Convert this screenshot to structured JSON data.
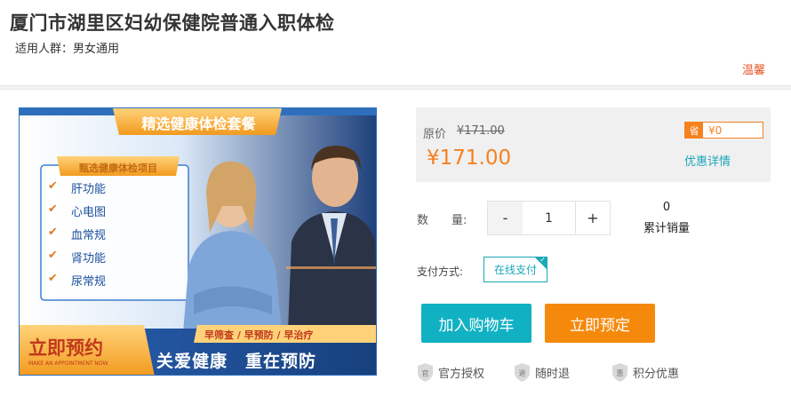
{
  "header": {
    "title": "厦门市湖里区妇幼保健院普通入职体检",
    "applicable": "适用人群：男女通用",
    "tag_link": "温馨"
  },
  "banner": {
    "title": "精选健康体检套餐",
    "subtitle": "甄选健康体检项目",
    "items": [
      "肝功能",
      "心电图",
      "血常规",
      "肾功能",
      "尿常规"
    ],
    "check_glyph": "✔",
    "cta": "立即预约",
    "cta_sub": "MAKE AN APPOINTMENT NOW",
    "strip": "早筛查 / 早预防 / 早治疗",
    "slogan": "关爱健康　重在预防"
  },
  "price": {
    "original_label": "原价",
    "original_value": "¥171.00",
    "current_value": "¥171.00",
    "save_icon_label": "省",
    "save_amount": "¥0",
    "promo_link": "优惠详情"
  },
  "quantity": {
    "label": "数　　量:",
    "minus": "-",
    "plus": "+",
    "value": "1",
    "sold_count": "0",
    "sold_label": "累计销量"
  },
  "payment": {
    "label": "支付方式:",
    "option": "在线支付",
    "check_glyph": "✓"
  },
  "buttons": {
    "add_to_cart": "加入购物车",
    "book_now": "立即预定"
  },
  "guarantees": [
    {
      "icon_char": "官",
      "label": "官方授权",
      "icon": "shield-icon"
    },
    {
      "icon_char": "退",
      "label": "随时退",
      "icon": "shield-icon"
    },
    {
      "icon_char": "惠",
      "label": "积分优惠",
      "icon": "shield-icon"
    }
  ],
  "colors": {
    "accent_orange": "#f5811f",
    "teal": "#11b1c4",
    "banner_blue": "#2e6fbd"
  }
}
